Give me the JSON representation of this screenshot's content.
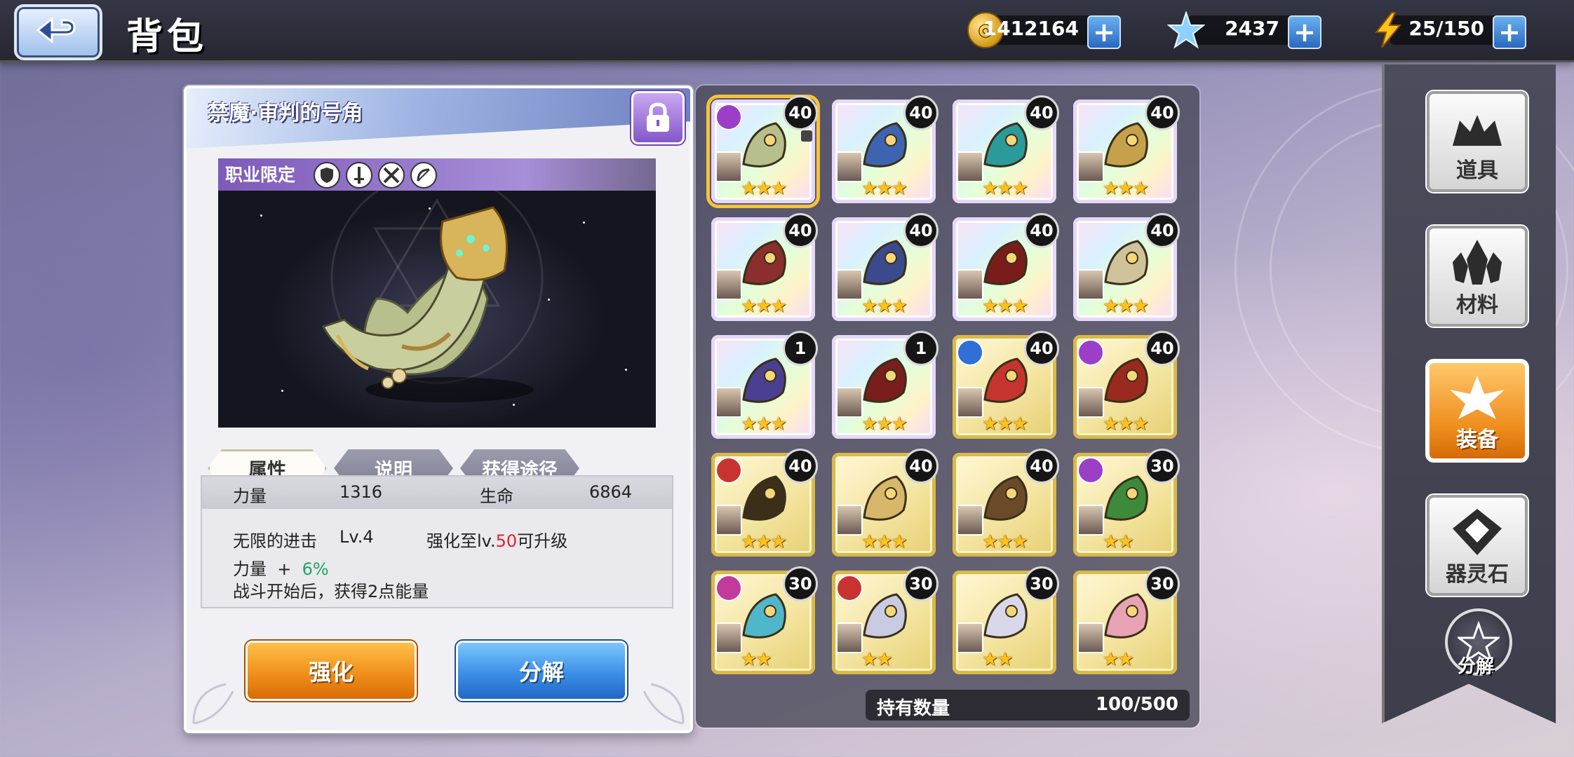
{
  "header": {
    "title": "背包",
    "resources": [
      {
        "icon": "gold-coin-icon",
        "value": "1412164"
      },
      {
        "icon": "blue-star-crystal-icon",
        "value": "2437"
      },
      {
        "icon": "lightning-stamina-icon",
        "value": "25/150"
      }
    ]
  },
  "detail": {
    "item_name": "禁魔·审判的号角",
    "job_restriction_label": "职业限定",
    "job_icons": [
      "shield-class-icon",
      "sword-class-icon",
      "crossed-swords-class-icon",
      "bow-class-icon"
    ],
    "tabs": [
      "属性",
      "说明",
      "获得途径"
    ],
    "active_tab": "属性",
    "stats": {
      "strength_label": "力量",
      "strength_value": "1316",
      "hp_label": "生命",
      "hp_value": "6864"
    },
    "skill": {
      "name": "无限的进击",
      "level": "Lv.4",
      "upgrade_prefix": "强化至lv.",
      "upgrade_level": "50",
      "upgrade_suffix": "可升级",
      "bonus_label": "力量",
      "bonus_sign": "+",
      "bonus_value": "6%",
      "effect": "战斗开始后，获得2点能量"
    },
    "buttons": {
      "enhance": "强化",
      "decompose": "分解"
    }
  },
  "grid": {
    "items": [
      {
        "level": "40",
        "frame": "rainbow",
        "stars": 3,
        "selected": true,
        "locked": true,
        "badge": "purple"
      },
      {
        "level": "40",
        "frame": "rainbow",
        "stars": 3,
        "badge": ""
      },
      {
        "level": "40",
        "frame": "rainbow",
        "stars": 3,
        "badge": ""
      },
      {
        "level": "40",
        "frame": "rainbow",
        "stars": 3,
        "badge": ""
      },
      {
        "level": "40",
        "frame": "rainbow",
        "stars": 3,
        "badge": ""
      },
      {
        "level": "40",
        "frame": "rainbow",
        "stars": 3,
        "badge": ""
      },
      {
        "level": "40",
        "frame": "rainbow",
        "stars": 3,
        "badge": ""
      },
      {
        "level": "40",
        "frame": "rainbow",
        "stars": 3,
        "badge": ""
      },
      {
        "level": "1",
        "frame": "rainbow",
        "stars": 3,
        "badge": ""
      },
      {
        "level": "1",
        "frame": "rainbow",
        "stars": 3,
        "badge": ""
      },
      {
        "level": "40",
        "frame": "gold",
        "stars": 3,
        "badge": "blue"
      },
      {
        "level": "40",
        "frame": "gold",
        "stars": 3,
        "badge": "purple"
      },
      {
        "level": "40",
        "frame": "gold",
        "stars": 3,
        "badge": "red"
      },
      {
        "level": "40",
        "frame": "gold",
        "stars": 3,
        "badge": ""
      },
      {
        "level": "40",
        "frame": "gold",
        "stars": 3,
        "badge": ""
      },
      {
        "level": "30",
        "frame": "gold",
        "stars": 2,
        "badge": "purple"
      },
      {
        "level": "30",
        "frame": "gold",
        "stars": 2,
        "badge": "magenta"
      },
      {
        "level": "30",
        "frame": "gold",
        "stars": 2,
        "badge": "red"
      },
      {
        "level": "30",
        "frame": "gold",
        "stars": 2,
        "badge": ""
      },
      {
        "level": "30",
        "frame": "gold",
        "stars": 2,
        "badge": ""
      }
    ],
    "quantity_label": "持有数量",
    "quantity_value": "100/500"
  },
  "sidebar": {
    "items": [
      {
        "label": "道具",
        "icon": "items-crown-icon",
        "active": false
      },
      {
        "label": "材料",
        "icon": "materials-crystal-icon",
        "active": false
      },
      {
        "label": "装备",
        "icon": "equipment-flower-icon",
        "active": true
      },
      {
        "label": "器灵石",
        "icon": "spirit-stone-icon",
        "active": false
      }
    ],
    "decompose_label": "分解"
  },
  "colors": {
    "accent_orange": "#f0901c",
    "accent_blue": "#3b8fe6",
    "upgrade_level_red": "#e2222e",
    "bonus_green": "#1fa65b",
    "star_gold": "#ffc21a"
  }
}
